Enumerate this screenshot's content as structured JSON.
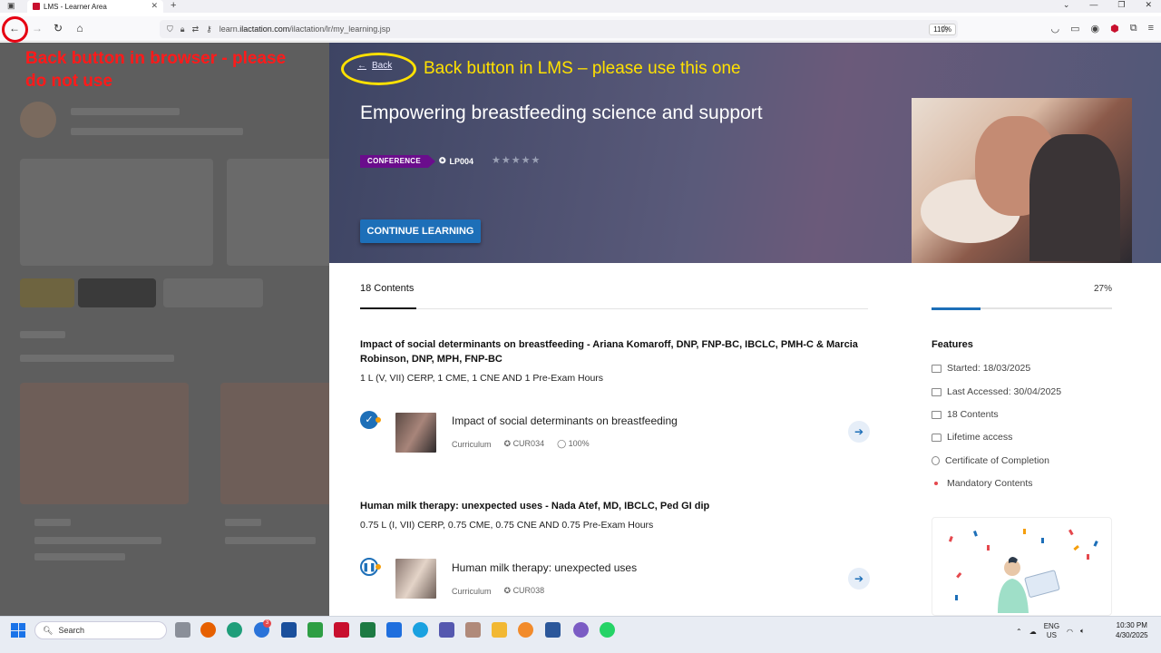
{
  "browser": {
    "tab_title": "LMS - Learner Area",
    "url_prefix": "learn.",
    "url_domain": "ilactation.com",
    "url_path": "/ilactation/lr/my_learning.jsp",
    "zoom": "110%"
  },
  "annotations": {
    "browser_back_note": "Back button in browser - please do not use",
    "lms_back_note": "Back button in LMS – please use this one"
  },
  "hero": {
    "back_label": "Back",
    "title": "Empowering breastfeeding science and support",
    "badge": "CONFERENCE",
    "code": "LP004",
    "continue_label": "CONTINUE LEARNING"
  },
  "main": {
    "contents_tab": "18 Contents",
    "progress_percent": "27%",
    "progress_value": 0.27,
    "sections": [
      {
        "title": "Impact of social determinants on breastfeeding - Ariana Komaroff, DNP, FNP-BC, IBCLC, PMH-C & Marcia Robinson, DNP, MPH, FNP-BC",
        "hours": "1 L (V, VII) CERP, 1 CME, 1 CNE AND 1 Pre-Exam Hours",
        "item": {
          "title": "Impact of social determinants on breastfeeding",
          "type": "Curriculum",
          "code": "CUR034",
          "progress": "100%",
          "status": "completed"
        }
      },
      {
        "title": "Human milk therapy: unexpected uses - Nada Atef, MD, IBCLC, Ped GI dip",
        "hours": "0.75 L (I, VII) CERP, 0.75 CME, 0.75 CNE AND 0.75 Pre-Exam Hours",
        "item": {
          "title": "Human milk therapy: unexpected uses",
          "type": "Curriculum",
          "code": "CUR038",
          "status": "paused"
        }
      }
    ]
  },
  "features": {
    "title": "Features",
    "items": [
      {
        "label": "Started: 18/03/2025",
        "icon": "calendar-icon"
      },
      {
        "label": "Last Accessed: 30/04/2025",
        "icon": "calendar-icon"
      },
      {
        "label": "18 Contents",
        "icon": "content-icon"
      },
      {
        "label": "Lifetime access",
        "icon": "lock-icon"
      },
      {
        "label": "Certificate of Completion",
        "icon": "certificate-icon"
      },
      {
        "label": "Mandatory Contents",
        "icon": "dot-icon"
      }
    ]
  },
  "taskbar": {
    "search_placeholder": "Search",
    "lang": "ENG",
    "region": "US",
    "time": "10:30 PM",
    "date": "4/30/2025",
    "notif_badge": "3"
  },
  "colors": {
    "accent": "#1d6fb8",
    "badge": "#6a0d8c",
    "annotation_red": "#ff1a1a",
    "annotation_yellow": "#ffe100"
  }
}
